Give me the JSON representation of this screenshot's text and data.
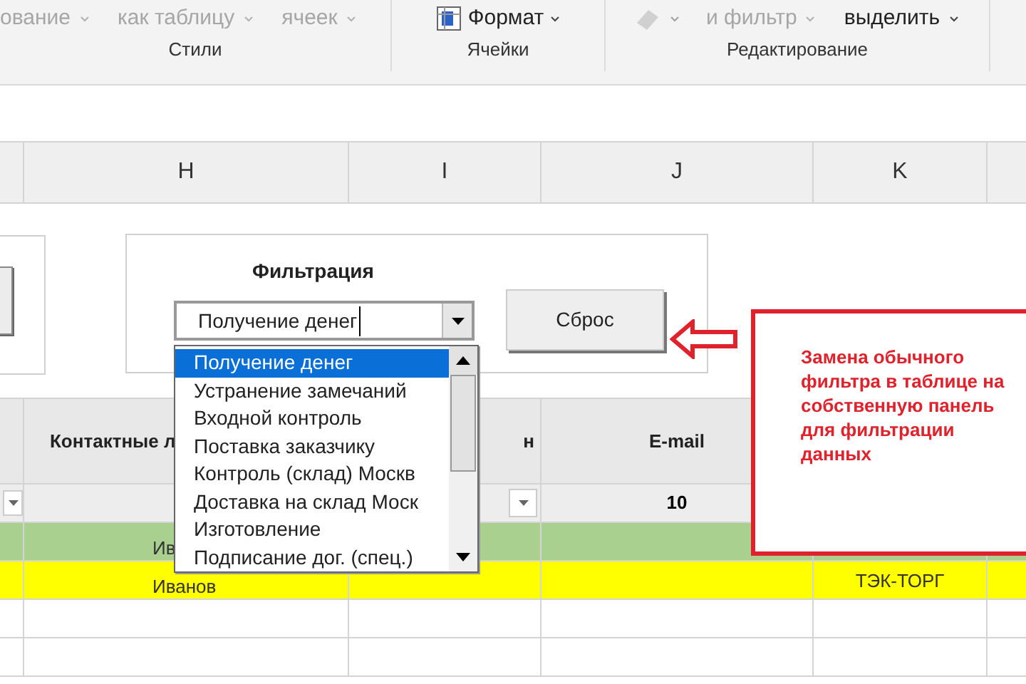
{
  "ribbon": {
    "groups": [
      {
        "label": "Стили",
        "items": [
          {
            "label": "ование",
            "disabled": true,
            "kind": "text"
          },
          {
            "label": "как таблицу",
            "disabled": true,
            "kind": "text"
          },
          {
            "label": "ячеек",
            "disabled": true,
            "kind": "text"
          }
        ]
      },
      {
        "label": "Ячейки",
        "items": [
          {
            "label": "Формат",
            "disabled": false,
            "kind": "format"
          }
        ]
      },
      {
        "label": "Редактирование",
        "items": [
          {
            "disabled": true,
            "kind": "eraser"
          },
          {
            "label": "и фильтр",
            "disabled": true,
            "kind": "text"
          },
          {
            "label": "выделить",
            "disabled": false,
            "kind": "text"
          }
        ]
      }
    ]
  },
  "column_headers": [
    "H",
    "I",
    "J",
    "K"
  ],
  "table": {
    "header": [
      "Контактные л",
      "н",
      "E-mail"
    ],
    "filter_row": [
      {
        "dropdown": true
      },
      {
        "value": "10"
      }
    ],
    "rows": [
      {
        "color": "#a9d08e",
        "cells": [
          "Ив",
          "",
          "",
          ""
        ]
      },
      {
        "color": "#ffff00",
        "cells": [
          "Иванов",
          "",
          "",
          "ТЭК-ТОРГ"
        ]
      },
      {
        "color": "#ffffff",
        "cells": [
          "",
          "",
          "",
          ""
        ]
      },
      {
        "color": "#ffffff",
        "cells": [
          "",
          "",
          "",
          ""
        ]
      }
    ]
  },
  "filter_panel": {
    "title": "Фильтрация",
    "combo_value": "Получение денег",
    "reset_button": "Сброс",
    "options": [
      {
        "label": "Получение денег",
        "selected": true
      },
      {
        "label": "Устранение замечаний",
        "selected": false
      },
      {
        "label": "Входной контроль",
        "selected": false
      },
      {
        "label": "Поставка заказчику",
        "selected": false
      },
      {
        "label": "Контроль (склад) Москв",
        "selected": false
      },
      {
        "label": "Доставка на склад Моск",
        "selected": false
      },
      {
        "label": "Изготовление",
        "selected": false
      },
      {
        "label": "Подписание дог. (спец.)",
        "selected": false
      }
    ]
  },
  "callout": {
    "text": "Замена обычного фильтра в таблице на собственную панель для фильтрации данных"
  }
}
